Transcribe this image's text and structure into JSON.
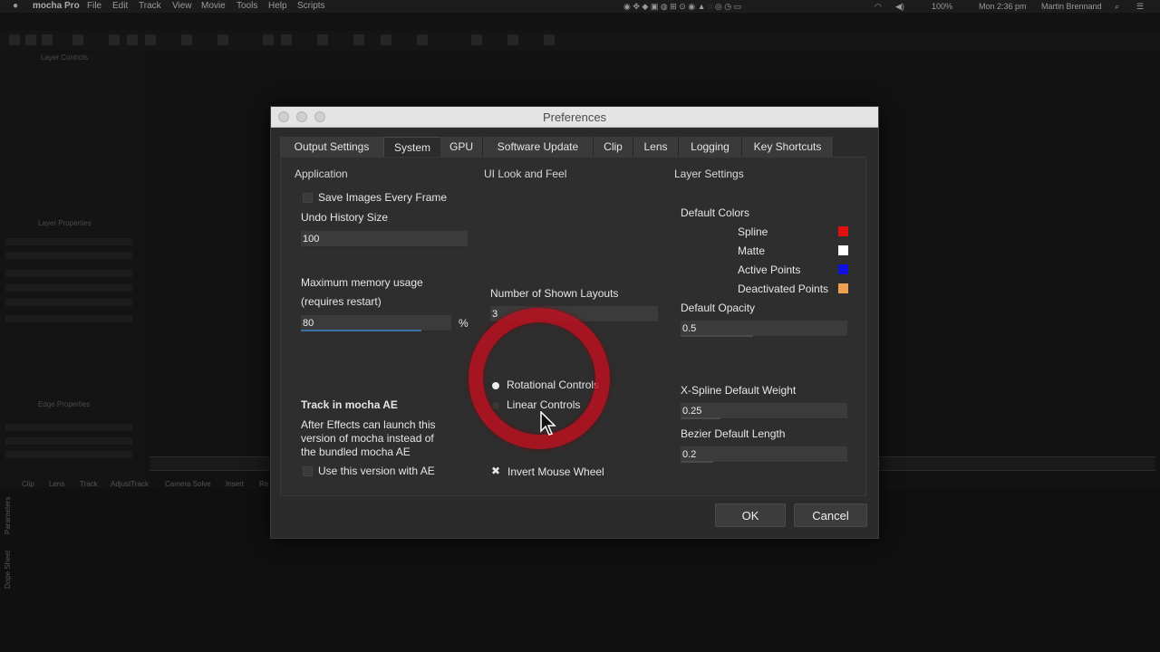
{
  "menubar": {
    "app_name": "mocha Pro",
    "items": [
      "File",
      "Edit",
      "Track",
      "View",
      "Movie",
      "Tools",
      "Help",
      "Scripts"
    ],
    "battery": "100%",
    "clock": "Mon 2:36 pm",
    "user": "Martin Brennand"
  },
  "background": {
    "layer_controls": "Layer Controls",
    "layer_properties": "Layer Properties",
    "edge_properties": "Edge Properties",
    "bottom_tabs": [
      "Clip",
      "Lens",
      "Track",
      "AdjustTrack",
      "Camera Solve",
      "Insert",
      "Re"
    ],
    "side_tabs": [
      "Parameters",
      "Dope Sheet"
    ]
  },
  "dialog": {
    "title": "Preferences",
    "tabs": [
      "Output Settings",
      "System",
      "GPU",
      "Software Update",
      "Clip",
      "Lens",
      "Logging",
      "Key Shortcuts"
    ],
    "active_tab": "System",
    "application": {
      "heading": "Application",
      "save_images_label": "Save Images Every Frame",
      "undo_label": "Undo History Size",
      "undo_value": "100",
      "memory_label_1": "Maximum memory usage",
      "memory_label_2": "(requires restart)",
      "memory_value": "80",
      "memory_unit": "%",
      "memory_fill_fraction": 0.8,
      "track_ae_heading": "Track in mocha AE",
      "track_ae_desc_1": "After Effects can launch this",
      "track_ae_desc_2": "version of mocha instead of",
      "track_ae_desc_3": "the bundled mocha AE",
      "use_version_label": "Use this version with AE"
    },
    "ui_look": {
      "heading": "UI Look and Feel",
      "layouts_label": "Number of Shown Layouts",
      "layouts_value": "3",
      "rotational_label": "Rotational Controls",
      "linear_label": "Linear Controls",
      "invert_label": "Invert Mouse Wheel"
    },
    "layer_settings": {
      "heading": "Layer Settings",
      "default_colors_label": "Default Colors",
      "spline_label": "Spline",
      "spline_color": "#e01010",
      "matte_label": "Matte",
      "matte_color": "#ffffff",
      "active_label": "Active Points",
      "active_color": "#1010e0",
      "deactivated_label": "Deactivated Points",
      "deactivated_color": "#f0a050",
      "opacity_label": "Default Opacity",
      "opacity_value": "0.5",
      "xspline_label": "X-Spline Default Weight",
      "xspline_value": "0.25",
      "bezier_label": "Bezier Default Length",
      "bezier_value": "0.2"
    },
    "ok_label": "OK",
    "cancel_label": "Cancel"
  }
}
